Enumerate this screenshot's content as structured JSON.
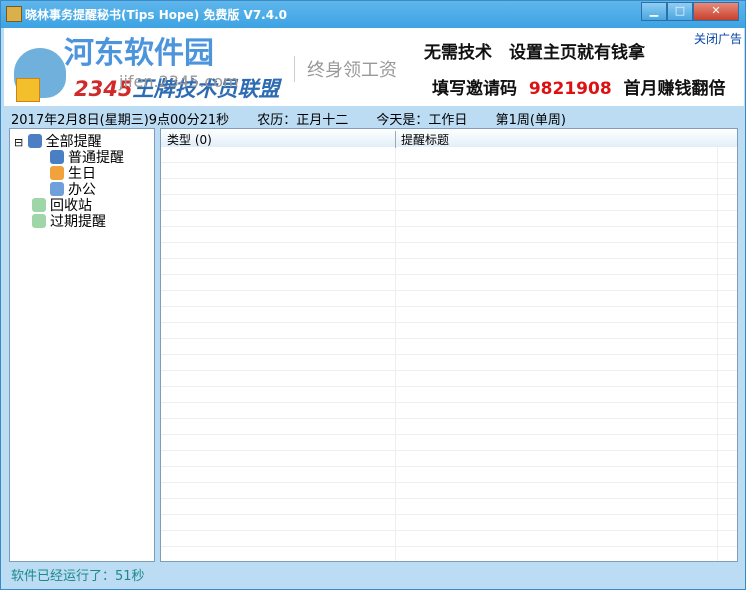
{
  "window": {
    "title": "晓林事务提醒秘书(Tips Hope) 免费版 V7.4.0",
    "minimize": "▁",
    "maximize": "□",
    "close": "✕"
  },
  "banner": {
    "watermark": "河东软件园",
    "logo_prefix": "2345",
    "logo_text": "王牌技术员联盟",
    "logo_url": "jifen.2345.com",
    "slogan": "终身领工资",
    "ad_line1": "无需技术　设置主页就有钱拿",
    "ad_line2_prefix": "填写邀请码",
    "invite_code": "9821908",
    "ad_line2_suffix": "首月赚钱翻倍",
    "close_ad": "关闭广告"
  },
  "info": {
    "datetime": "2017年2月8日(星期三)9点00分21秒",
    "lunar": "农历：正月十二",
    "today": "今天是：工作日",
    "week": "第1周(单周)"
  },
  "tree": {
    "expander": "⊟",
    "root": "全部提醒",
    "children": [
      "普通提醒",
      "生日",
      "办公"
    ],
    "recycle": "回收站",
    "expired": "过期提醒"
  },
  "list": {
    "columns": [
      "类型 (0)",
      "提醒标题"
    ]
  },
  "status": "软件已经运行了：51秒"
}
